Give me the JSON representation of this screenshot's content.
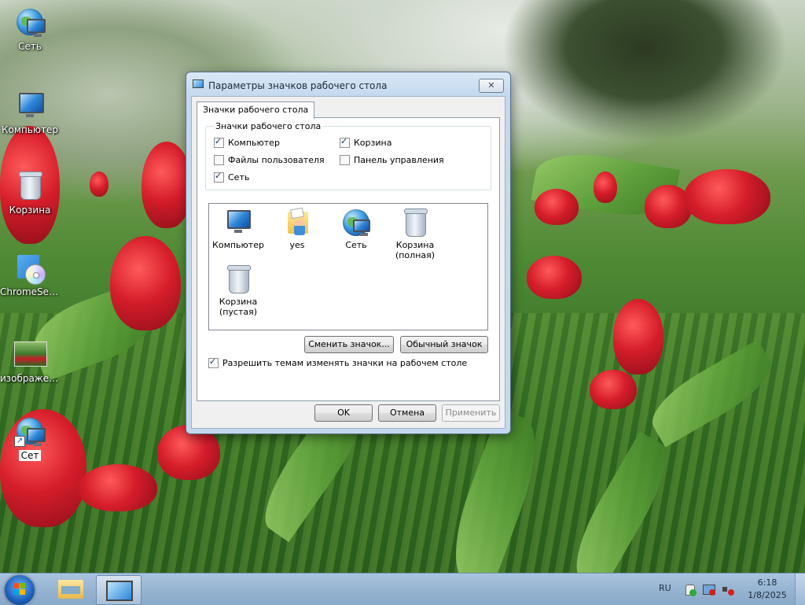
{
  "desktop": {
    "icons": [
      {
        "label": "Сеть"
      },
      {
        "label": "Компьютер"
      },
      {
        "label": "Корзина"
      },
      {
        "label": "ChromeSet..."
      },
      {
        "label": "изображен..."
      },
      {
        "label": "Сет"
      }
    ]
  },
  "dialog": {
    "title": "Параметры значков рабочего стола",
    "close_glyph": "✕",
    "tab_label": "Значки рабочего стола",
    "group_title": "Значки рабочего стола",
    "checkboxes": [
      {
        "label": "Компьютер",
        "checked": true
      },
      {
        "label": "Корзина",
        "checked": true
      },
      {
        "label": "Файлы пользователя",
        "checked": false
      },
      {
        "label": "Панель управления",
        "checked": false
      },
      {
        "label": "Сеть",
        "checked": true
      }
    ],
    "icon_list": [
      {
        "label": "Компьютер",
        "icon": "computer-icon"
      },
      {
        "label": "yes",
        "icon": "user-folder-icon"
      },
      {
        "label": "Сеть",
        "icon": "network-icon"
      },
      {
        "label": "Корзина (полная)",
        "icon": "recycle-bin-full-icon"
      },
      {
        "label": "Корзина (пустая)",
        "icon": "recycle-bin-empty-icon"
      }
    ],
    "change_icon_label": "Сменить значок...",
    "default_icon_label": "Обычный значок",
    "allow_themes_label": "Разрешить темам изменять значки на рабочем столе",
    "allow_themes_checked": true,
    "ok_label": "OK",
    "cancel_label": "Отмена",
    "apply_label": "Применить"
  },
  "taskbar": {
    "language": "RU",
    "time": "6:18",
    "date": "1/8/2025"
  }
}
